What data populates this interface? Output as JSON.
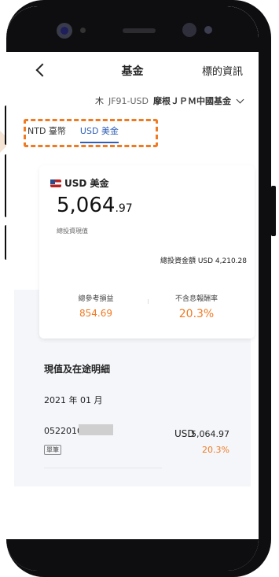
{
  "header": {
    "title": "基金",
    "info": "標的資訊"
  },
  "fund": {
    "code": "JF91-USD",
    "name": "摩根ＪＰＭ中國基金"
  },
  "tabs": [
    {
      "label": "NTD 臺幣"
    },
    {
      "label": "USD 美金",
      "active": true
    }
  ],
  "card": {
    "currency": "USD 美金",
    "amount_int": "5,064",
    "amount_dec": ".97",
    "current_value_label": "總投資現值",
    "invested_label": "總投資金額 USD 4,210.28",
    "pnl_label": "總參考損益",
    "pnl_value": "854.69",
    "return_label": "不含息報酬率",
    "return_value": "20.3%"
  },
  "detail": {
    "title": "現值及在途明細",
    "month": "2021 年 01 月",
    "account": "0522010",
    "tag": "單筆",
    "currency": "USD",
    "value": "5,064.97",
    "return": "20.3%"
  }
}
